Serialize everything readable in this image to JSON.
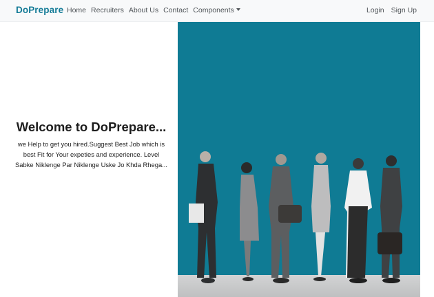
{
  "navbar": {
    "brand": "DoPrepare",
    "links": [
      "Home",
      "Recruiters",
      "About Us",
      "Contact",
      "Components"
    ],
    "right_links": [
      "Login",
      "Sign Up"
    ],
    "brand_color": "#127a96"
  },
  "hero": {
    "title": "Welcome to DoPrepare...",
    "body": "we Help to get you hired.Suggest Best Job which is best Fit for Your expeties and experience. Level Sabke Niklenge Par Niklenge Uske Jo Khda Rhega...",
    "image_background": "#0f7b94"
  }
}
